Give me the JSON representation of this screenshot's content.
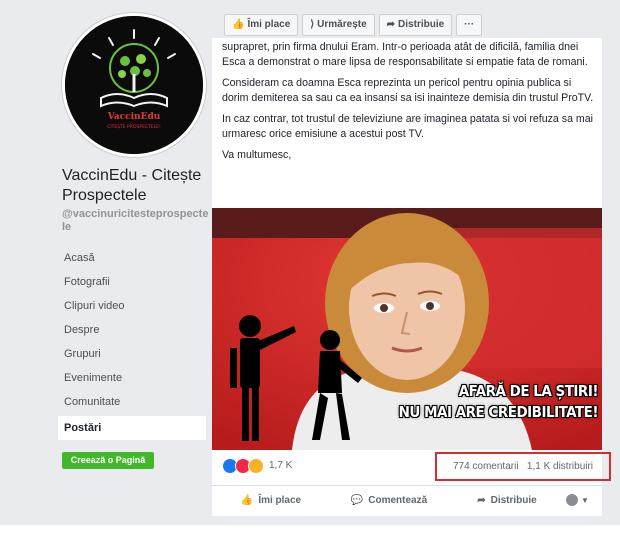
{
  "toolbar": {
    "like_label": "Îmi place",
    "follow_label": "Urmărește",
    "share_label": "Distribuie",
    "more_label": "···"
  },
  "sidebar": {
    "page_name": "VaccinEdu - Citește Prospectele",
    "handle": "@vaccinuricitesteprospectele",
    "logo_text_1": "VaccinEdu",
    "logo_text_2": "CITEȘTE PROSPECTELE!",
    "nav": [
      "Acasă",
      "Fotografii",
      "Clipuri video",
      "Despre",
      "Grupuri",
      "Evenimente",
      "Comunitate",
      "Postări"
    ],
    "active_nav": "Postări",
    "create_page_label": "Creează o Pagină"
  },
  "post": {
    "paragraphs": [
      "suprapret, prin firma dnului Eram. Intr-o perioada atât de dificilă, familia dnei Esca a demonstrat o mare lipsa de responsabilitate si empatie fata de romani.",
      "Consideram ca doamna Esca reprezinta un pericol pentru opinia publica si dorim demiterea sa sau ca ea insansi sa isi inainteze demisia din trustul ProTV.",
      "In caz contrar, tot trustul de televiziune are imaginea patata si voi refuza sa mai urmaresc orice emisiune a acestui post TV.",
      "Va multumesc,"
    ],
    "image_caption_1": "AFARĂ DE LA ȘTIRI!",
    "image_caption_2": "NU MAI ARE CREDIBILITATE!",
    "reaction_count": "1,7 K",
    "comments": "774 comentarii",
    "shares": "1,1 K distribuiri",
    "actions": {
      "like": "Îmi place",
      "comment": "Comentează",
      "share": "Distribuie"
    }
  },
  "colors": {
    "facebook_blue": "#4267b2",
    "highlight_red": "#d32f2f",
    "create_green": "#42b72a"
  }
}
